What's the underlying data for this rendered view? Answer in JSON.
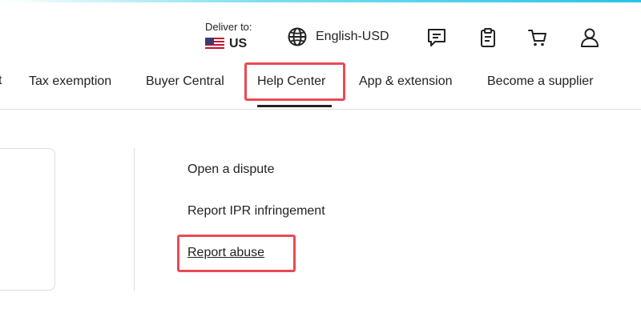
{
  "header": {
    "deliver_label": "Deliver to:",
    "country_code": "US",
    "flag_icon": "us-flag-icon",
    "language": "English-USD",
    "icons": [
      "globe-icon",
      "message-icon",
      "clipboard-icon",
      "cart-icon",
      "user-icon"
    ]
  },
  "nav": {
    "cut_item": "t",
    "items": [
      "Tax exemption",
      "Buyer Central",
      "Help Center",
      "App & extension",
      "Become a supplier"
    ],
    "active_item": "Help Center"
  },
  "menu": {
    "items": [
      "Open a dispute",
      "Report IPR infringement",
      "Report abuse"
    ],
    "highlighted_item": "Report abuse"
  },
  "colors": {
    "highlight": "#ea4a55",
    "text": "#222222",
    "divider": "#dddddd",
    "accent": "#27c3e6"
  }
}
